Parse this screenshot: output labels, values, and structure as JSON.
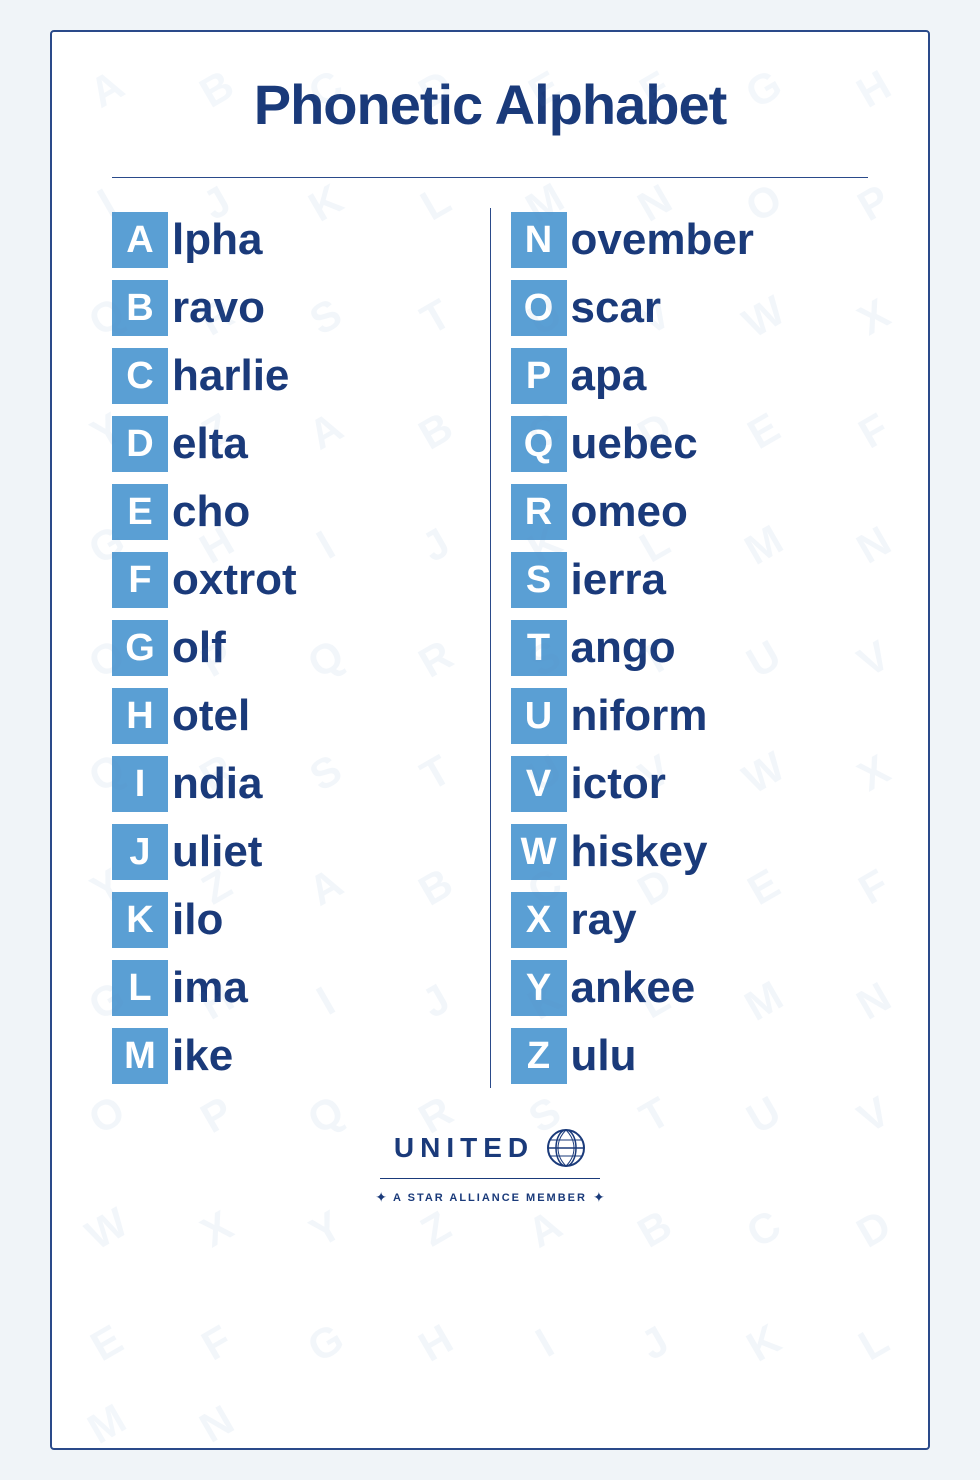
{
  "page": {
    "title": "Phonetic Alphabet",
    "brand": {
      "name": "UNITED",
      "tagline": "A STAR ALLIANCE MEMBER"
    },
    "left_column": [
      {
        "letter": "A",
        "rest": "lpha"
      },
      {
        "letter": "B",
        "rest": "ravo"
      },
      {
        "letter": "C",
        "rest": "harlie"
      },
      {
        "letter": "D",
        "rest": "elta"
      },
      {
        "letter": "E",
        "rest": "cho"
      },
      {
        "letter": "F",
        "rest": "oxtrot"
      },
      {
        "letter": "G",
        "rest": "olf"
      },
      {
        "letter": "H",
        "rest": "otel"
      },
      {
        "letter": "I",
        "rest": "ndia"
      },
      {
        "letter": "J",
        "rest": "uliet"
      },
      {
        "letter": "K",
        "rest": "ilo"
      },
      {
        "letter": "L",
        "rest": "ima"
      },
      {
        "letter": "M",
        "rest": "ike"
      }
    ],
    "right_column": [
      {
        "letter": "N",
        "rest": "ovember"
      },
      {
        "letter": "O",
        "rest": "scar"
      },
      {
        "letter": "P",
        "rest": "apa"
      },
      {
        "letter": "Q",
        "rest": "uebec"
      },
      {
        "letter": "R",
        "rest": "omeo"
      },
      {
        "letter": "S",
        "rest": "ierra"
      },
      {
        "letter": "T",
        "rest": "ango"
      },
      {
        "letter": "U",
        "rest": "niform"
      },
      {
        "letter": "V",
        "rest": "ictor"
      },
      {
        "letter": "W",
        "rest": "hiskey"
      },
      {
        "letter": "X",
        "rest": "ray"
      },
      {
        "letter": "Y",
        "rest": "ankee"
      },
      {
        "letter": "Z",
        "rest": "ulu"
      }
    ],
    "watermark_letters": [
      "A",
      "B",
      "C",
      "D",
      "E",
      "F",
      "G",
      "H",
      "I",
      "J",
      "K",
      "L",
      "M",
      "N",
      "O",
      "P",
      "Q",
      "R",
      "S",
      "T",
      "U",
      "V",
      "W",
      "X",
      "Y",
      "Z",
      "A",
      "B",
      "C",
      "D",
      "E",
      "F",
      "G",
      "H",
      "I",
      "J",
      "K",
      "L",
      "M",
      "N",
      "O",
      "P",
      "Q",
      "R",
      "S",
      "T",
      "U",
      "V",
      "Q",
      "R",
      "S",
      "T",
      "U",
      "V",
      "W",
      "X",
      "Y",
      "Z",
      "A",
      "B",
      "C",
      "D",
      "E",
      "F",
      "G",
      "H",
      "I",
      "J",
      "K",
      "L",
      "M",
      "N",
      "O",
      "P",
      "Q",
      "R",
      "S",
      "T",
      "U",
      "V",
      "W",
      "X",
      "Y",
      "Z",
      "A",
      "B",
      "C",
      "D",
      "E",
      "F",
      "G",
      "H",
      "I",
      "J",
      "K",
      "L",
      "M",
      "N"
    ]
  }
}
